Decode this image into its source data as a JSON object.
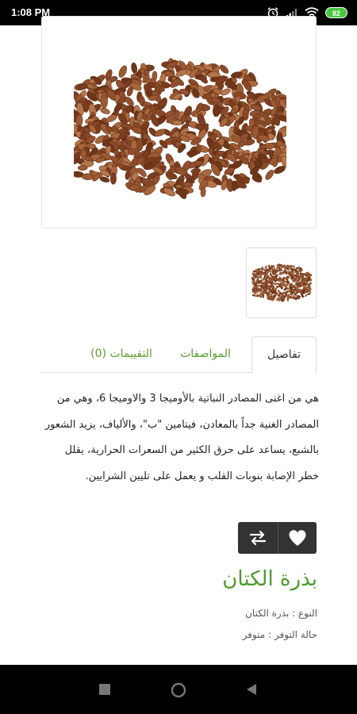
{
  "status_bar": {
    "time": "1:08 PM",
    "battery": "82",
    "icons": [
      "alarm-icon",
      "signal-icon",
      "wifi-icon",
      "battery-icon"
    ]
  },
  "product": {
    "name": "بذرة الكتان",
    "image": "flax-seeds-image",
    "thumbnail": "flax-seeds-thumbnail"
  },
  "tabs": [
    {
      "label": "تفاصيل",
      "active": true
    },
    {
      "label": "المواصفات",
      "active": false
    },
    {
      "label": "التقييمات (0)",
      "active": false
    }
  ],
  "description": "هي من اغنى المصادر النباتية بالأوميجا 3 والاوميجا 6، وهي من المصادر الغنية جداً بالمعادن، فيتامين \"ب\"، والألياف، يزيد الشعور بالشبع، يساعد على حرق الكثير من السعرات الحرارية، يقلل خطر الإصابة بنوبات القلب و يعمل على تليين الشرايين.",
  "actions": {
    "favorite_icon": "heart-icon",
    "compare_icon": "compare-arrows-icon"
  },
  "meta": {
    "type": "النوع : بذرة الكتان",
    "availability": "حالة التوفر : متوفر"
  },
  "colors": {
    "accent_green": "#4e9a2b",
    "tab_green": "#5a9e2f",
    "action_bg": "#333333"
  },
  "nav_bar": {
    "buttons": [
      "recents-button",
      "home-button",
      "back-button"
    ]
  }
}
